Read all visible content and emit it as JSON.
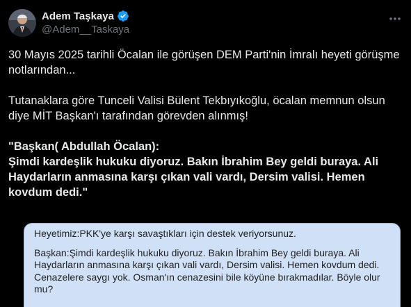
{
  "author": {
    "display_name": "Adem Taşkaya",
    "handle": "@Adem__Taskaya"
  },
  "icons": {
    "avatar": "avatar-photo",
    "verified": "verified-badge-icon",
    "more": "more-options-icon"
  },
  "colors": {
    "background": "#000000",
    "verified": "#1d9bf0",
    "note_card": "#cfe0f7"
  },
  "tweet": {
    "para1": "30 Mayıs 2025 tarihli Öcalan ile görüşen DEM Parti'nin İmralı heyeti görüşme notlarından...",
    "para2": "Tutanaklara göre Tunceli Valisi Bülent Tekbıyıkoğlu, öcalan memnun olsun diye MİT Başkan'ı tarafından görevden alınmış!",
    "para3_line1": "\"Başkan( Abdullah Öcalan):",
    "para3_line2": "Şimdi kardeşlik hukuku diyoruz. Bakın İbrahim Bey geldi buraya. Ali Haydarların anmasına karşı çıkan vali vardı, Dersim valisi. Hemen kovdum dedi.\""
  },
  "note": {
    "question": "Heyetimiz:PKK'ye karşı savaştıkları için destek veriyorsunuz.",
    "answer": "Başkan:Şimdi kardeşlik hukuku diyoruz. Bakın İbrahim Bey geldi buraya. Ali Haydarların anmasına karşı çıkan vali vardı, Dersim valisi. Hemen kovdum dedi. Cenazelere saygı yok. Osman'ın cenazesini bile köyüne bırakmadılar. Böyle olur mu?"
  }
}
